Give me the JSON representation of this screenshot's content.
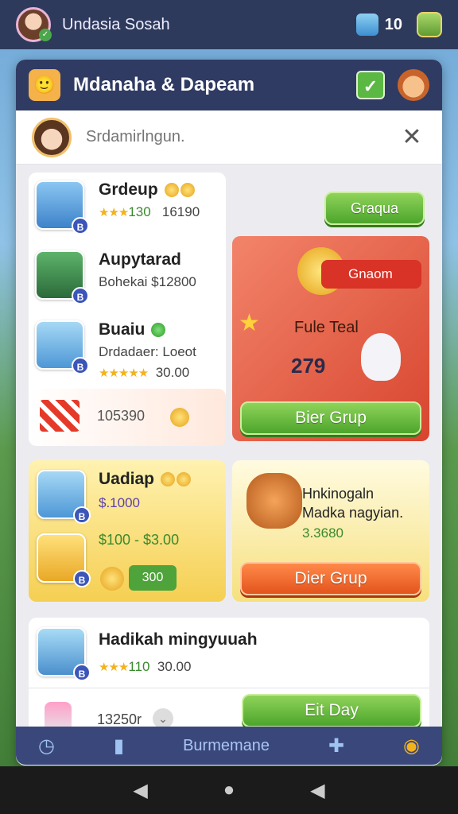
{
  "colors": {
    "topbar": "#2e3a5c",
    "panel_header": "#2f3b63",
    "green_button": "#5bb843",
    "orange_button": "#e3541d",
    "promo_red": "#e8523a",
    "card_yellow": "#f8d35a"
  },
  "topbar": {
    "username": "Undasia Sosah",
    "coins": "10",
    "avatar_icon": "player-avatar-icon",
    "coin_icon": "gem-coin-icon",
    "store_icon": "store-icon"
  },
  "panel": {
    "title": "Mdanaha & Dapeam",
    "header_icon": "avatar-head-icon",
    "check_icon": "check-icon",
    "face_icon": "monkey-face-icon"
  },
  "search": {
    "placeholder": "Srdamirlngun.",
    "close_icon": "close-icon"
  },
  "items": [
    {
      "name": "Grdeup",
      "rating": "★★★",
      "level": "130",
      "price": "16190",
      "lvl_badge": "B"
    },
    {
      "name": "Aupytarad",
      "desc": "Bohekai $12800",
      "lvl_badge": "B"
    },
    {
      "name": "Buaiu",
      "desc": "Drdadaer: Loeot",
      "rating": "★★★★★",
      "price": "30.00",
      "lvl_badge": "B"
    },
    {
      "promo_price": "105390"
    }
  ],
  "promo": {
    "tag_button": "Graqua",
    "badge": "Gnaom",
    "label": "Fule Teal",
    "count": "279",
    "button": "Bier Grup"
  },
  "yellow_card": {
    "name": "Uadiap",
    "price": "$.1000",
    "range": "$100 - $3.00",
    "pill": "300"
  },
  "quest_card": {
    "title": "Hnkinogaln",
    "subtitle": "Madka nagyian.",
    "amount": "3.3680",
    "button": "Dier Grup"
  },
  "bottom_item": {
    "name": "Hadikah mingyuuah",
    "rating": "★★★",
    "level": "110",
    "price": "30.00",
    "lvl_badge": "B",
    "count": "13250r",
    "button": "Eit Day"
  },
  "nav": {
    "label": "Burmemane",
    "icons": [
      "clock-icon",
      "cards-icon",
      "puzzle-icon",
      "globe-icon"
    ]
  },
  "android": {
    "back": "◀",
    "home": "●",
    "recent": "◀"
  }
}
